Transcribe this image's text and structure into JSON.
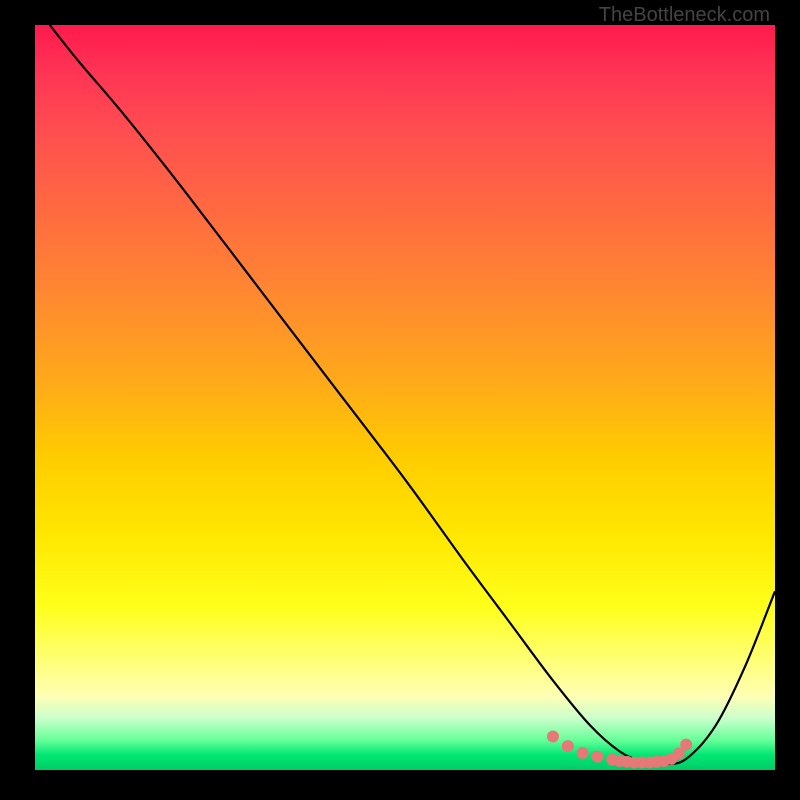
{
  "watermark": "TheBottleneck.com",
  "chart_data": {
    "type": "line",
    "title": "",
    "xlabel": "",
    "ylabel": "",
    "xlim": [
      0,
      100
    ],
    "ylim": [
      0,
      100
    ],
    "curve": {
      "name": "bottleneck-curve",
      "x": [
        2,
        6,
        12,
        20,
        30,
        40,
        50,
        58,
        64,
        70,
        75,
        79,
        82,
        85,
        88,
        92,
        96,
        100
      ],
      "y": [
        100,
        95,
        88,
        78,
        65,
        52,
        39,
        28,
        20,
        12,
        6,
        2.5,
        1.2,
        0.8,
        1.5,
        6,
        14,
        24
      ]
    },
    "highlight_points": {
      "name": "minimum-region",
      "color": "#e67878",
      "x": [
        70,
        72,
        74,
        76,
        78,
        79,
        80,
        81,
        82,
        83,
        84,
        85,
        86,
        87,
        88
      ],
      "y": [
        4.5,
        3.2,
        2.3,
        1.8,
        1.4,
        1.2,
        1.1,
        1.0,
        1.0,
        1.0,
        1.1,
        1.2,
        1.5,
        2.2,
        3.4
      ]
    }
  }
}
